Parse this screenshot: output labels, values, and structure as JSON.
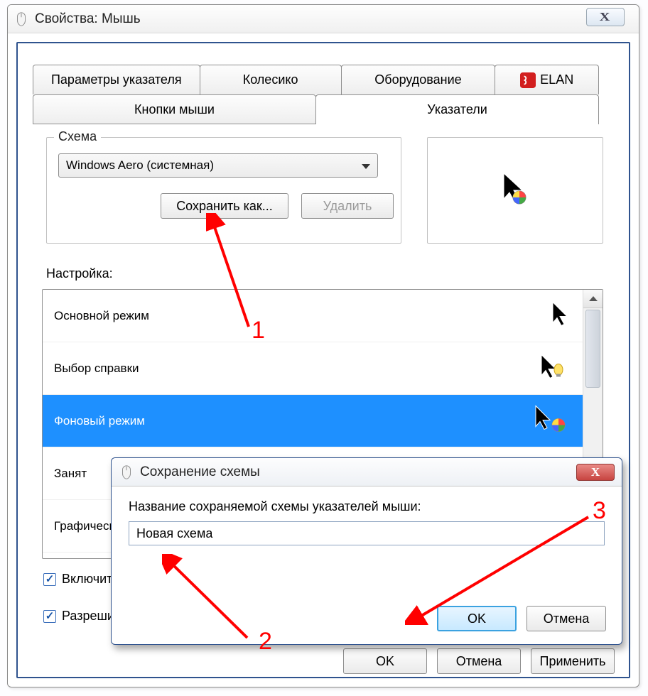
{
  "window": {
    "title": "Свойства: Мышь",
    "close_glyph": "X"
  },
  "tabs": {
    "params": "Параметры указателя",
    "wheel": "Колесико",
    "hardware": "Оборудование",
    "elan": "ELAN",
    "buttons": "Кнопки мыши",
    "pointers": "Указатели"
  },
  "scheme": {
    "group_label": "Схема",
    "selected": "Windows Aero (системная)",
    "save_as": "Сохранить как...",
    "delete": "Удалить"
  },
  "settings_label": "Настройка:",
  "list": {
    "items": [
      "Основной режим",
      "Выбор справки",
      "Фоновый режим",
      "Занят",
      "Графическ"
    ],
    "selected_index": 2
  },
  "checkboxes": {
    "shadow": "Включить",
    "allow_themes": "Разреши"
  },
  "buttons": {
    "ok": "OK",
    "cancel": "Отмена",
    "apply": "Применить"
  },
  "overlay": {
    "title": "Сохранение схемы",
    "prompt": "Название сохраняемой схемы указателей мыши:",
    "value": "Новая схема",
    "ok": "OK",
    "cancel": "Отмена",
    "close_glyph": "X"
  },
  "annotations": {
    "a1": "1",
    "a2": "2",
    "a3": "3"
  }
}
